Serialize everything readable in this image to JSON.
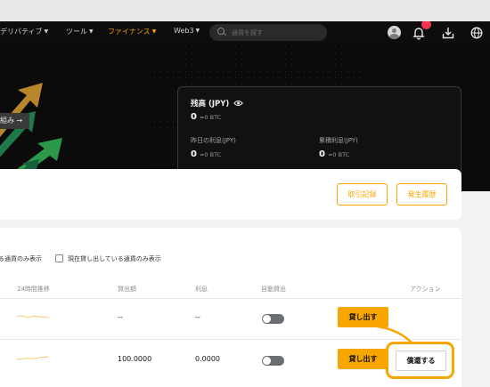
{
  "nav": {
    "items": [
      {
        "label": "デリバティブ",
        "active": false
      },
      {
        "label": "ツール",
        "active": false
      },
      {
        "label": "ファイナンス",
        "active": true
      },
      {
        "label": "Web3",
        "active": false
      }
    ],
    "search_placeholder": "通貨を探す",
    "icons": [
      "avatar-icon",
      "bell-icon",
      "download-icon",
      "globe-icon"
    ]
  },
  "hero": {
    "link_label": "組み →"
  },
  "balance": {
    "title": "残高 (JPY)",
    "value": "0",
    "btc": "≈0 BTC",
    "yesterday_label": "昨日の利息(JPY)",
    "yesterday_value": "0",
    "yesterday_btc": "≈0 BTC",
    "total_label": "累積利息(JPY)",
    "total_value": "0",
    "total_btc": "≈0 BTC"
  },
  "records": {
    "history_label": "取引記録",
    "occurrence_label": "発生履歴"
  },
  "filters": {
    "filter1": "る通貨のみ表示",
    "filter2": "現在貸し出している通貨のみ表示"
  },
  "table": {
    "headers": {
      "trend": "24時間推移",
      "lent": "貸出額",
      "interest": "利息",
      "auto": "自動貸出",
      "action": "アクション"
    },
    "rows": [
      {
        "lent": "--",
        "interest": "--",
        "auto_on": false,
        "lend_label": "貸し出す"
      },
      {
        "lent": "100.0000",
        "interest": "0.0000",
        "auto_on": false,
        "lend_label": "貸し出す",
        "repay_label": "償還する"
      }
    ]
  },
  "colors": {
    "accent": "#f7a600",
    "nav_bg": "#0d0d0d",
    "badge": "#f0344c"
  }
}
